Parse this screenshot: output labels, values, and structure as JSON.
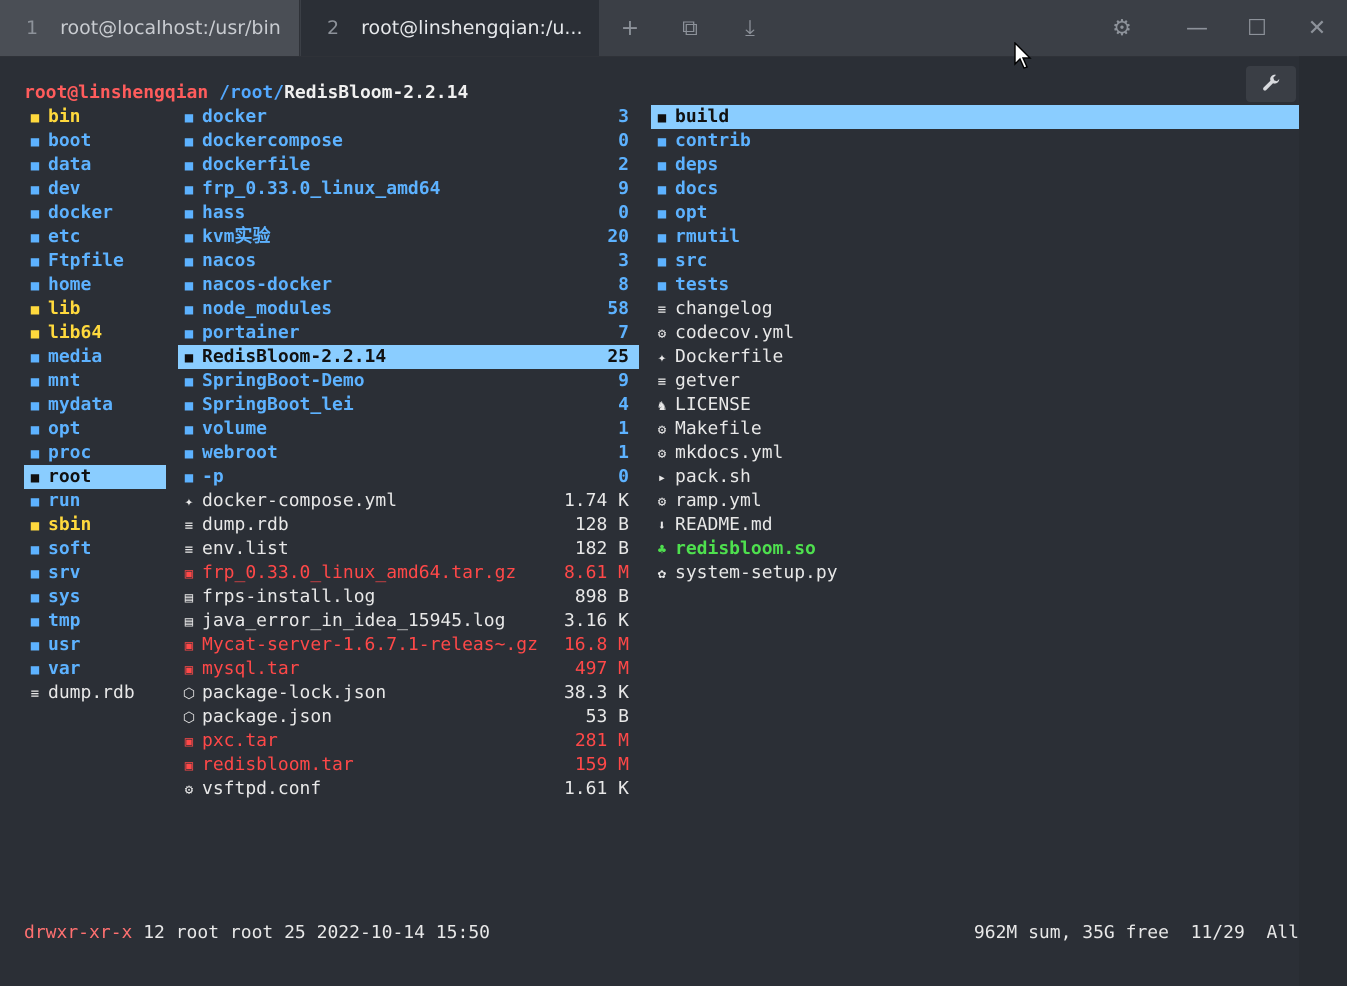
{
  "tabs": [
    {
      "num": "1",
      "title": "root@localhost:/usr/bin"
    },
    {
      "num": "2",
      "title": "root@linshengqian:/u..."
    }
  ],
  "toolbar": {
    "new_tab": "+",
    "split": "⧉",
    "download": "⤓",
    "settings": "⚙",
    "minimize": "—",
    "maximize": "☐",
    "close": "✕"
  },
  "prompt": {
    "user": "root@linshengqian",
    "path": " /root/",
    "current": "RedisBloom-2.2.14"
  },
  "left": [
    {
      "name": "bin",
      "icon": "■",
      "kind": "ydir"
    },
    {
      "name": "boot",
      "icon": "■",
      "kind": "dir"
    },
    {
      "name": "data",
      "icon": "■",
      "kind": "dir"
    },
    {
      "name": "dev",
      "icon": "■",
      "kind": "dir"
    },
    {
      "name": "docker",
      "icon": "■",
      "kind": "dir"
    },
    {
      "name": "etc",
      "icon": "■",
      "kind": "dir"
    },
    {
      "name": "Ftpfile",
      "icon": "■",
      "kind": "dir"
    },
    {
      "name": "home",
      "icon": "■",
      "kind": "dir"
    },
    {
      "name": "lib",
      "icon": "■",
      "kind": "ydir"
    },
    {
      "name": "lib64",
      "icon": "■",
      "kind": "ydir"
    },
    {
      "name": "media",
      "icon": "■",
      "kind": "dir"
    },
    {
      "name": "mnt",
      "icon": "■",
      "kind": "dir"
    },
    {
      "name": "mydata",
      "icon": "■",
      "kind": "dir"
    },
    {
      "name": "opt",
      "icon": "■",
      "kind": "dir"
    },
    {
      "name": "proc",
      "icon": "■",
      "kind": "dir"
    },
    {
      "name": "root",
      "icon": "■",
      "kind": "dir",
      "selected": true
    },
    {
      "name": "run",
      "icon": "■",
      "kind": "dir"
    },
    {
      "name": "sbin",
      "icon": "■",
      "kind": "ydir"
    },
    {
      "name": "soft",
      "icon": "■",
      "kind": "dir"
    },
    {
      "name": "srv",
      "icon": "■",
      "kind": "dir"
    },
    {
      "name": "sys",
      "icon": "■",
      "kind": "dir"
    },
    {
      "name": "tmp",
      "icon": "■",
      "kind": "dir"
    },
    {
      "name": "usr",
      "icon": "■",
      "kind": "dir"
    },
    {
      "name": "var",
      "icon": "■",
      "kind": "dir"
    },
    {
      "name": "dump.rdb",
      "icon": "≡",
      "kind": "file"
    }
  ],
  "middle": [
    {
      "name": "docker",
      "size": "3",
      "icon": "■",
      "kind": "dir"
    },
    {
      "name": "dockercompose",
      "size": "0",
      "icon": "■",
      "kind": "dir"
    },
    {
      "name": "dockerfile",
      "size": "2",
      "icon": "■",
      "kind": "dir"
    },
    {
      "name": "frp_0.33.0_linux_amd64",
      "size": "9",
      "icon": "■",
      "kind": "dir"
    },
    {
      "name": "hass",
      "size": "0",
      "icon": "■",
      "kind": "dir"
    },
    {
      "name": "kvm实验",
      "size": "20",
      "icon": "■",
      "kind": "dir"
    },
    {
      "name": "nacos",
      "size": "3",
      "icon": "■",
      "kind": "dir"
    },
    {
      "name": "nacos-docker",
      "size": "8",
      "icon": "■",
      "kind": "dir"
    },
    {
      "name": "node_modules",
      "size": "58",
      "icon": "■",
      "kind": "dir"
    },
    {
      "name": "portainer",
      "size": "7",
      "icon": "■",
      "kind": "dir"
    },
    {
      "name": "RedisBloom-2.2.14",
      "size": "25",
      "icon": "■",
      "kind": "dir",
      "selected": true
    },
    {
      "name": "SpringBoot-Demo",
      "size": "9",
      "icon": "■",
      "kind": "dir"
    },
    {
      "name": "SpringBoot_lei",
      "size": "4",
      "icon": "■",
      "kind": "dir"
    },
    {
      "name": "volume",
      "size": "1",
      "icon": "■",
      "kind": "dir"
    },
    {
      "name": "webroot",
      "size": "1",
      "icon": "■",
      "kind": "dir"
    },
    {
      "name": "-p",
      "size": "0",
      "icon": "■",
      "kind": "dir"
    },
    {
      "name": "docker-compose.yml",
      "size": "1.74 K",
      "icon": "✦",
      "kind": "file"
    },
    {
      "name": "dump.rdb",
      "size": "128 B",
      "icon": "≡",
      "kind": "file"
    },
    {
      "name": "env.list",
      "size": "182 B",
      "icon": "≡",
      "kind": "file"
    },
    {
      "name": "frp_0.33.0_linux_amd64.tar.gz",
      "size": "8.61 M",
      "icon": "▣",
      "kind": "arc"
    },
    {
      "name": "frps-install.log",
      "size": "898 B",
      "icon": "▤",
      "kind": "file"
    },
    {
      "name": "java_error_in_idea_15945.log",
      "size": "3.16 K",
      "icon": "▤",
      "kind": "file"
    },
    {
      "name": "Mycat-server-1.6.7.1-releas~.gz",
      "size": "16.8 M",
      "icon": "▣",
      "kind": "arc"
    },
    {
      "name": "mysql.tar",
      "size": "497 M",
      "icon": "▣",
      "kind": "arc"
    },
    {
      "name": "package-lock.json",
      "size": "38.3 K",
      "icon": "⬡",
      "kind": "file"
    },
    {
      "name": "package.json",
      "size": "53 B",
      "icon": "⬡",
      "kind": "file"
    },
    {
      "name": "pxc.tar",
      "size": "281 M",
      "icon": "▣",
      "kind": "arc"
    },
    {
      "name": "redisbloom.tar",
      "size": "159 M",
      "icon": "▣",
      "kind": "arc"
    },
    {
      "name": "vsftpd.conf",
      "size": "1.61 K",
      "icon": "⚙",
      "kind": "file"
    }
  ],
  "right": [
    {
      "name": "build",
      "icon": "■",
      "kind": "dir",
      "selected": true
    },
    {
      "name": "contrib",
      "icon": "■",
      "kind": "dir"
    },
    {
      "name": "deps",
      "icon": "■",
      "kind": "dir"
    },
    {
      "name": "docs",
      "icon": "■",
      "kind": "dir"
    },
    {
      "name": "opt",
      "icon": "■",
      "kind": "dir"
    },
    {
      "name": "rmutil",
      "icon": "■",
      "kind": "dir"
    },
    {
      "name": "src",
      "icon": "■",
      "kind": "dir"
    },
    {
      "name": "tests",
      "icon": "■",
      "kind": "dir"
    },
    {
      "name": "changelog",
      "icon": "≡",
      "kind": "file"
    },
    {
      "name": "codecov.yml",
      "icon": "⚙",
      "kind": "file"
    },
    {
      "name": "Dockerfile",
      "icon": "✦",
      "kind": "file"
    },
    {
      "name": "getver",
      "icon": "≡",
      "kind": "file"
    },
    {
      "name": "LICENSE",
      "icon": "♞",
      "kind": "file"
    },
    {
      "name": "Makefile",
      "icon": "⚙",
      "kind": "file"
    },
    {
      "name": "mkdocs.yml",
      "icon": "⚙",
      "kind": "file"
    },
    {
      "name": "pack.sh",
      "icon": "▸",
      "kind": "file"
    },
    {
      "name": "ramp.yml",
      "icon": "⚙",
      "kind": "file"
    },
    {
      "name": "README.md",
      "icon": "⬇",
      "kind": "file"
    },
    {
      "name": "redisbloom.so",
      "icon": "♣",
      "kind": "exe"
    },
    {
      "name": "system-setup.py",
      "icon": "✿",
      "kind": "file"
    }
  ],
  "status": {
    "perms": "drwxr-xr-x",
    "info": " 12 root root 25 2022-10-14 15:50",
    "summary": "962M sum, 35G free  11/29  All"
  }
}
